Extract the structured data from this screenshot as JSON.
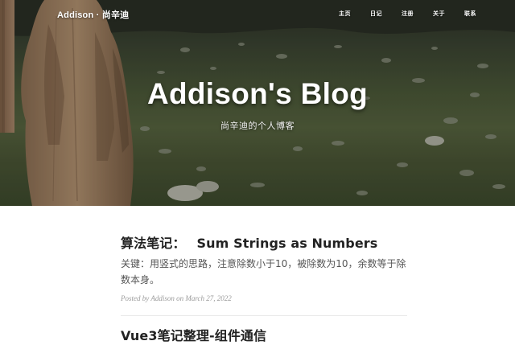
{
  "site": {
    "brand": "Addison · 尚辛迪",
    "nav": [
      "主页",
      "日记",
      "注册",
      "关于",
      "联系"
    ]
  },
  "hero": {
    "title": "Addison's Blog",
    "subtitle": "尚辛迪的个人博客"
  },
  "posts": [
    {
      "title_cn": "算法笔记：",
      "title_en": "Sum Strings as Numbers",
      "subtitle": "关键：用竖式的思路，注意除数小于10，被除数为10，余数等于除数本身。",
      "meta_prefix": "Posted by",
      "author": "Addison",
      "meta_on": "on",
      "date": "March 27, 2022"
    },
    {
      "title": "Vue3笔记整理-组件通信"
    }
  ]
}
